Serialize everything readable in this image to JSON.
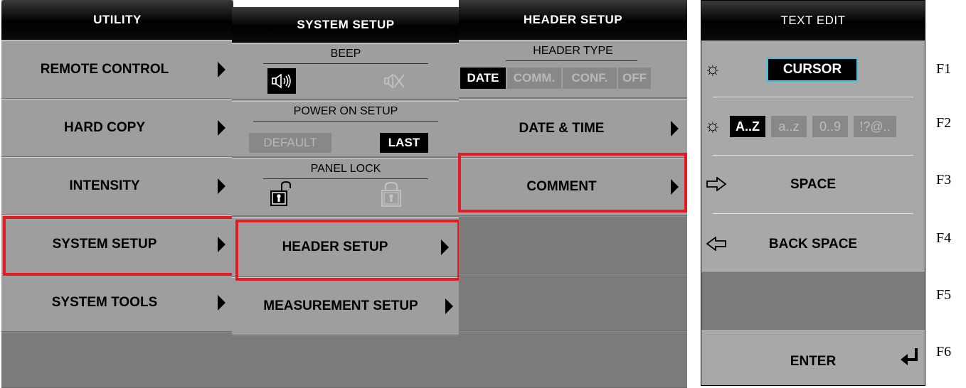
{
  "utility": {
    "title": "UTILITY",
    "items": [
      {
        "label": "REMOTE CONTROL"
      },
      {
        "label": "HARD COPY"
      },
      {
        "label": "INTENSITY"
      },
      {
        "label": "SYSTEM SETUP"
      },
      {
        "label": "SYSTEM TOOLS"
      }
    ]
  },
  "system_setup": {
    "title": "SYSTEM SETUP",
    "beep": {
      "label": "BEEP",
      "icons": [
        "speaker-on-icon",
        "speaker-mute-icon"
      ]
    },
    "power_on": {
      "label": "POWER ON SETUP",
      "options": [
        "DEFAULT",
        "LAST"
      ],
      "selected": "LAST"
    },
    "panel_lock": {
      "label": "PANEL LOCK",
      "icons": [
        "lock-open-icon",
        "lock-closed-icon"
      ]
    },
    "items": [
      {
        "label": "HEADER SETUP"
      },
      {
        "label": "MEASUREMENT SETUP"
      }
    ]
  },
  "header_setup": {
    "title": "HEADER SETUP",
    "header_type": {
      "label": "HEADER TYPE",
      "options": [
        "DATE",
        "COMM.",
        "CONF.",
        "OFF"
      ],
      "selected": "DATE"
    },
    "items": [
      {
        "label": "DATE & TIME"
      },
      {
        "label": "COMMENT"
      }
    ]
  },
  "text_edit": {
    "title": "TEXT EDIT",
    "cursor_label": "CURSOR",
    "char_sets": [
      "A..Z",
      "a..z",
      "0..9",
      "!?@.."
    ],
    "selected_char_set": "A..Z",
    "space_label": "SPACE",
    "back_space_label": "BACK SPACE",
    "enter_label": "ENTER"
  },
  "function_keys": [
    "F1",
    "F2",
    "F3",
    "F4",
    "F5",
    "F6"
  ],
  "colors": {
    "highlight": "#e21b24",
    "panel": "#9e9e9e",
    "empty_key": "#7b7b7b",
    "header": "#000000",
    "cursor_border": "#3ec3e0"
  }
}
